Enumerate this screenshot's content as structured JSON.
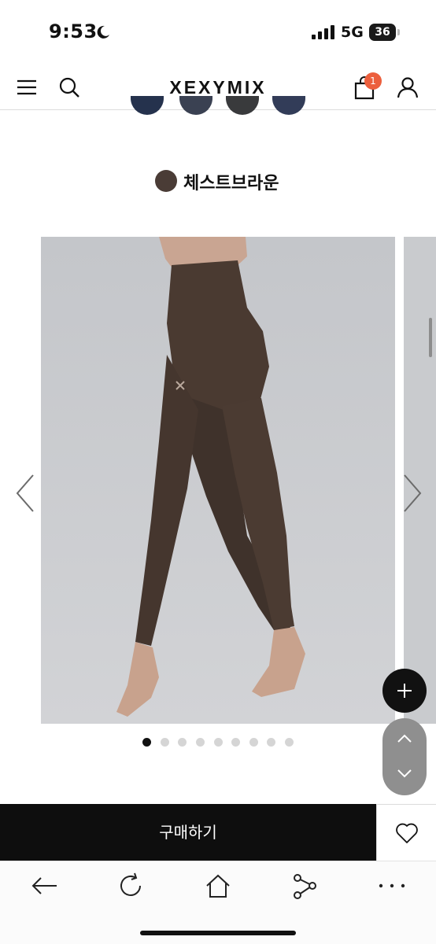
{
  "status_bar": {
    "time": "9:53",
    "network": "5G",
    "battery": "36",
    "icons": [
      "moon-icon",
      "signal-icon",
      "battery-icon"
    ]
  },
  "header": {
    "logo": "XEXYMIX",
    "cart_count": "1",
    "icons": [
      "menu-icon",
      "search-icon",
      "cart-icon",
      "user-icon"
    ]
  },
  "product": {
    "selected_color_name": "체스트브라운",
    "selected_color_hex": "#4a3c36",
    "gallery": {
      "image_description_icon": "product-photo-placeholder",
      "total_slides": 9,
      "active_slide": 1
    }
  },
  "actions": {
    "buy_label": "구매하기",
    "icons": [
      "plus-icon",
      "chevron-up-icon",
      "chevron-down-icon",
      "heart-icon"
    ]
  },
  "browser": {
    "icons": [
      "back-arrow-icon",
      "reload-icon",
      "home-icon",
      "share-icon",
      "more-icon"
    ]
  },
  "colors": {
    "accent": "#ec5f3d",
    "buy_bar": "#0e0e0e",
    "photo_background": "#c9cbce"
  }
}
